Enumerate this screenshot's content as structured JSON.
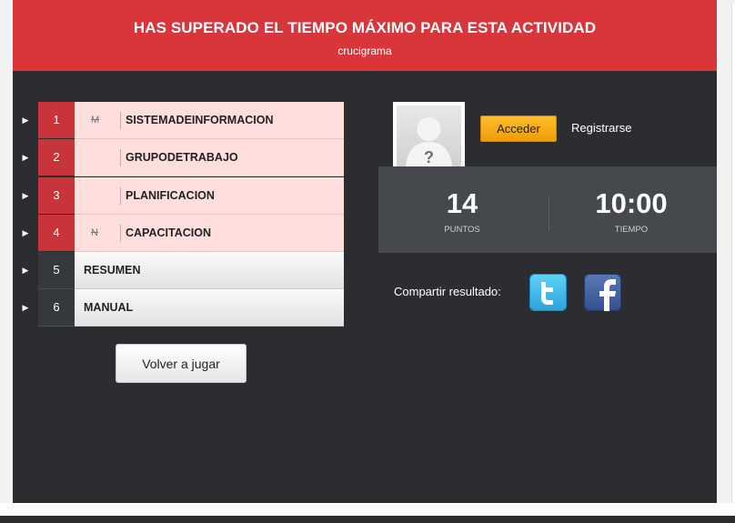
{
  "header": {
    "title": "HAS SUPERADO EL TIEMPO MÁXIMO PARA ESTA ACTIVIDAD",
    "subtitle": "crucigrama"
  },
  "answers": [
    {
      "number": "1",
      "hint": "M",
      "word": "SISTEMADEINFORMACION"
    },
    {
      "number": "2",
      "hint": "",
      "word": "GRUPODETRABAJO"
    },
    {
      "number": "3",
      "hint": "",
      "word": "PLANIFICACION"
    },
    {
      "number": "4",
      "hint": "N",
      "word": "CAPACITACION"
    }
  ],
  "sections": [
    {
      "number": "5",
      "label": "RESUMEN"
    },
    {
      "number": "6",
      "label": "MANUAL"
    }
  ],
  "replay_label": "Volver a jugar",
  "user": {
    "login_label": "Acceder",
    "register_label": "Registrarse",
    "avatar_icon": "user-placeholder-icon"
  },
  "score": {
    "points_value": "14",
    "points_label": "PUNTOS",
    "time_value": "10:00",
    "time_label": "TIEMPO"
  },
  "share": {
    "label": "Compartir resultado:",
    "twitter_icon": "twitter-icon",
    "facebook_icon": "facebook-icon"
  },
  "colors": {
    "header": "#d9363c",
    "background": "#2b2d31",
    "pending_row": "#ffdede",
    "accent_button": "#f19b07"
  }
}
